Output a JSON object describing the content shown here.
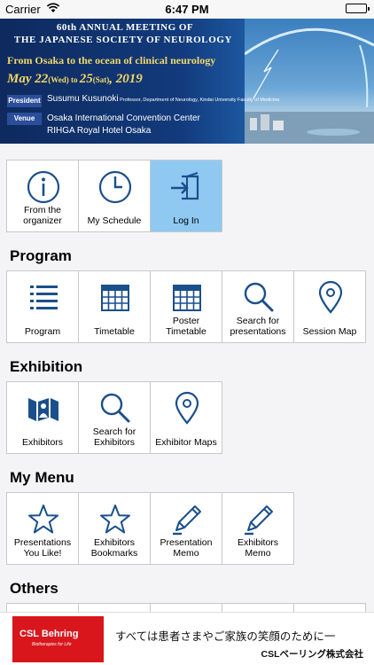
{
  "status_bar": {
    "carrier": "Carrier",
    "time": "6:47 PM"
  },
  "banner": {
    "line1": "60th ANNUAL MEETING OF",
    "line2": "THE JAPANESE SOCIETY OF NEUROLOGY",
    "theme": "From Osaka to the ocean of clinical neurology",
    "date_may": "May 22",
    "date_wed": "(Wed)",
    "date_to": " to ",
    "date_end": "25",
    "date_sat": "(Sat)",
    "date_year": ", 2019",
    "president_tag": "President",
    "president_name": "Susumu Kusunoki",
    "president_affil": " Professor, Department of Neurology, Kindai University Faculty of Medicine",
    "venue_tag": "Venue",
    "venue_line1": "Osaka International Convention Center",
    "venue_line2": "RIHGA Royal Hotel Osaka"
  },
  "top_menu": [
    {
      "label": "From the\norganizer",
      "icon": "info-icon"
    },
    {
      "label": "My Schedule",
      "icon": "clock-icon"
    },
    {
      "label": "Log In",
      "icon": "login-icon",
      "active": true
    }
  ],
  "sections": {
    "program": {
      "title": "Program",
      "items": [
        {
          "label": "Program",
          "icon": "list-icon"
        },
        {
          "label": "Timetable",
          "icon": "calendar-icon"
        },
        {
          "label": "Poster\nTimetable",
          "icon": "calendar-icon"
        },
        {
          "label": "Search for\npresentations",
          "icon": "search-icon"
        },
        {
          "label": "Session Map",
          "icon": "map-pin-icon"
        }
      ]
    },
    "exhibition": {
      "title": "Exhibition",
      "items": [
        {
          "label": "Exhibitors",
          "icon": "exhibitors-icon"
        },
        {
          "label": "Search for\nExhibitors",
          "icon": "search-icon"
        },
        {
          "label": "Exhibitor Maps",
          "icon": "map-pin-icon"
        }
      ]
    },
    "my_menu": {
      "title": "My Menu",
      "items": [
        {
          "label": "Presentations\nYou Like!",
          "icon": "star-icon"
        },
        {
          "label": "Exhibitors\nBookmarks",
          "icon": "star-icon"
        },
        {
          "label": "Presentation\nMemo",
          "icon": "pencil-icon"
        },
        {
          "label": "Exhibitors\nMemo",
          "icon": "pencil-icon"
        }
      ]
    },
    "others": {
      "title": "Others"
    }
  },
  "ad": {
    "brand": "CSL Behring",
    "brand_sub": "Biotherapies for Life",
    "slogan": "すべては患者さまやご家族の笑顔のために一",
    "company": "CSLベーリング株式会社"
  },
  "colors": {
    "icon_blue": "#1a4f8b",
    "active_tile": "#8fc9f2",
    "ad_red": "#d9161c"
  }
}
